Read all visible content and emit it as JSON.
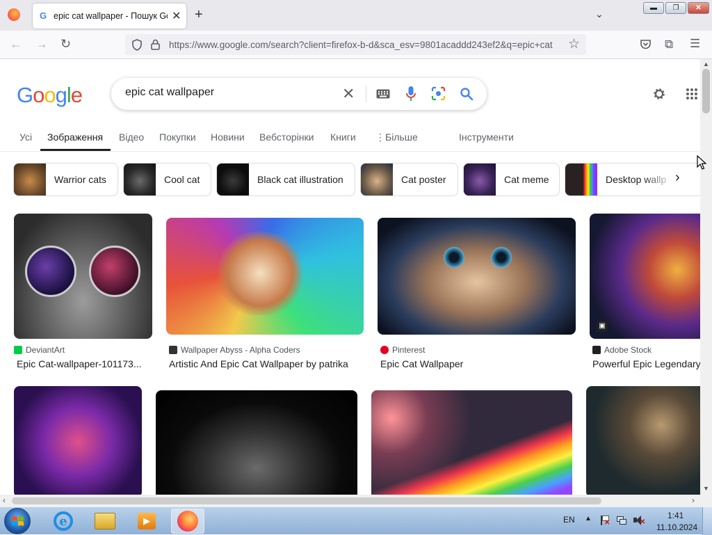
{
  "browser": {
    "tab_title": "epic cat wallpaper - Пошук Google",
    "tab_favicon": "G",
    "url_domain": "https://www.google.com",
    "url_rest": "/search?client=firefox-b-d&sca_esv=9801acaddd243ef2&q=epic+cat"
  },
  "google": {
    "logo": "Google",
    "query": "epic cat wallpaper",
    "tabs": [
      "Усі",
      "Зображення",
      "Відео",
      "Покупки",
      "Новини",
      "Вебсторінки",
      "Книги",
      "Більше",
      "Інструменти"
    ],
    "chips": [
      "Warrior cats",
      "Cool cat",
      "Black cat illustration",
      "Cat poster",
      "Cat meme",
      "Desktop wallp"
    ],
    "results": [
      {
        "source": "DeviantArt",
        "caption": "Epic Cat-wallpaper-101173..."
      },
      {
        "source": "Wallpaper Abyss - Alpha Coders",
        "caption": "Artistic And Epic Cat Wallpaper by patrika"
      },
      {
        "source": "Pinterest",
        "caption": "Epic Cat Wallpaper"
      },
      {
        "source": "Adobe Stock",
        "caption": "Powerful Epic Legendary"
      }
    ]
  },
  "taskbar": {
    "lang": "EN",
    "time": "1:41",
    "date": "11.10.2024"
  },
  "colors": {
    "google_blue": "#4285f4",
    "google_red": "#ea4335",
    "google_yellow": "#fbbc05",
    "google_green": "#34a853"
  }
}
